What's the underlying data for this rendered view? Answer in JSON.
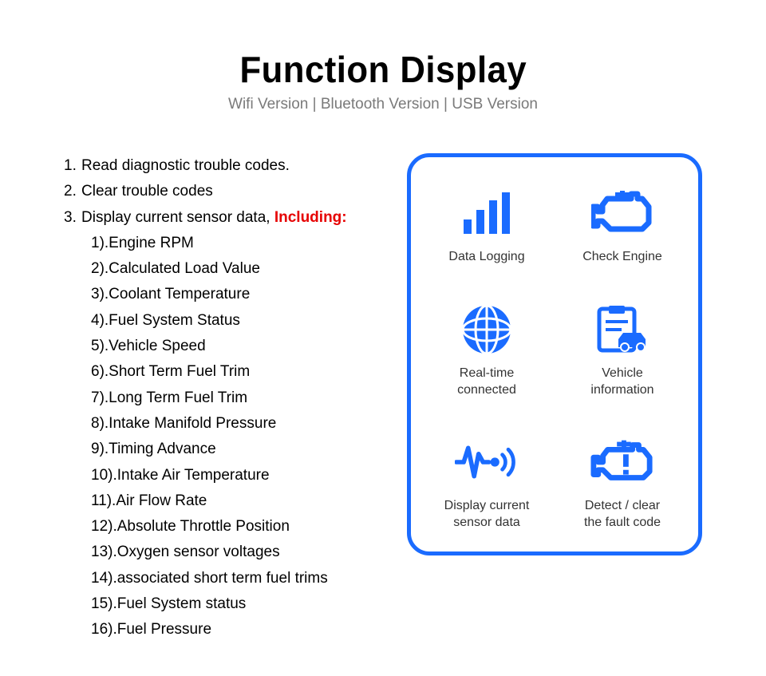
{
  "header": {
    "title": "Function Display",
    "subtitle": "Wifi Version | Bluetooth Version | USB Version"
  },
  "functions": {
    "item1_num": "1.",
    "item1_text": "Read diagnostic trouble codes.",
    "item2_num": "2.",
    "item2_text": "Clear trouble codes",
    "item3_num": "3.",
    "item3_text": "Display current sensor data, ",
    "item3_highlight": "Including:",
    "sub": {
      "s1": "1).Engine RPM",
      "s2": "2).Calculated Load Value",
      "s3": "3).Coolant Temperature",
      "s4": "4).Fuel System Status",
      "s5": "5).Vehicle Speed",
      "s6": "6).Short Term Fuel Trim",
      "s7": "7).Long Term Fuel Trim",
      "s8": "8).Intake Manifold Pressure",
      "s9": "9).Timing Advance",
      "s10": "10).Intake Air Temperature",
      "s11": "11).Air Flow Rate",
      "s12": "12).Absolute Throttle Position",
      "s13": "13).Oxygen sensor voltages",
      "s14": "14).associated short term fuel trims",
      "s15": "15).Fuel System status",
      "s16": "16).Fuel Pressure"
    }
  },
  "tiles": {
    "t1": "Data Logging",
    "t2": "Check Engine",
    "t3a": "Real-time",
    "t3b": "connected",
    "t4a": "Vehicle",
    "t4b": "information",
    "t5a": "Display current",
    "t5b": "sensor data",
    "t6a": "Detect / clear",
    "t6b": "the fault code"
  },
  "colors": {
    "accent": "#1a6bff",
    "highlight": "#e60000"
  }
}
